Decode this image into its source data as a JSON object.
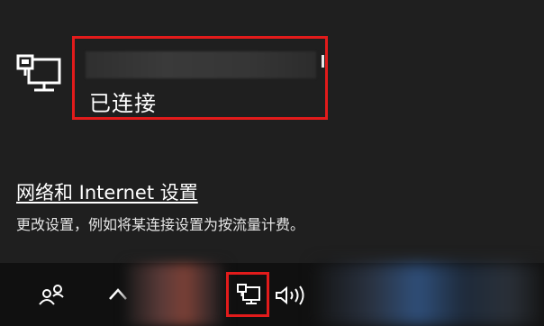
{
  "network": {
    "name": "",
    "status": "已连接",
    "icon": "ethernet-monitor-icon"
  },
  "settings": {
    "link": "网络和 Internet 设置",
    "description": "更改设置，例如将某连接设置为按流量计费。"
  },
  "taskbar": {
    "icons": [
      "people-icon",
      "chevron-up-icon",
      "network-icon",
      "volume-icon"
    ]
  },
  "colors": {
    "background": "#1f1f1f",
    "taskbar": "#101010",
    "highlight": "#e21b1b"
  }
}
